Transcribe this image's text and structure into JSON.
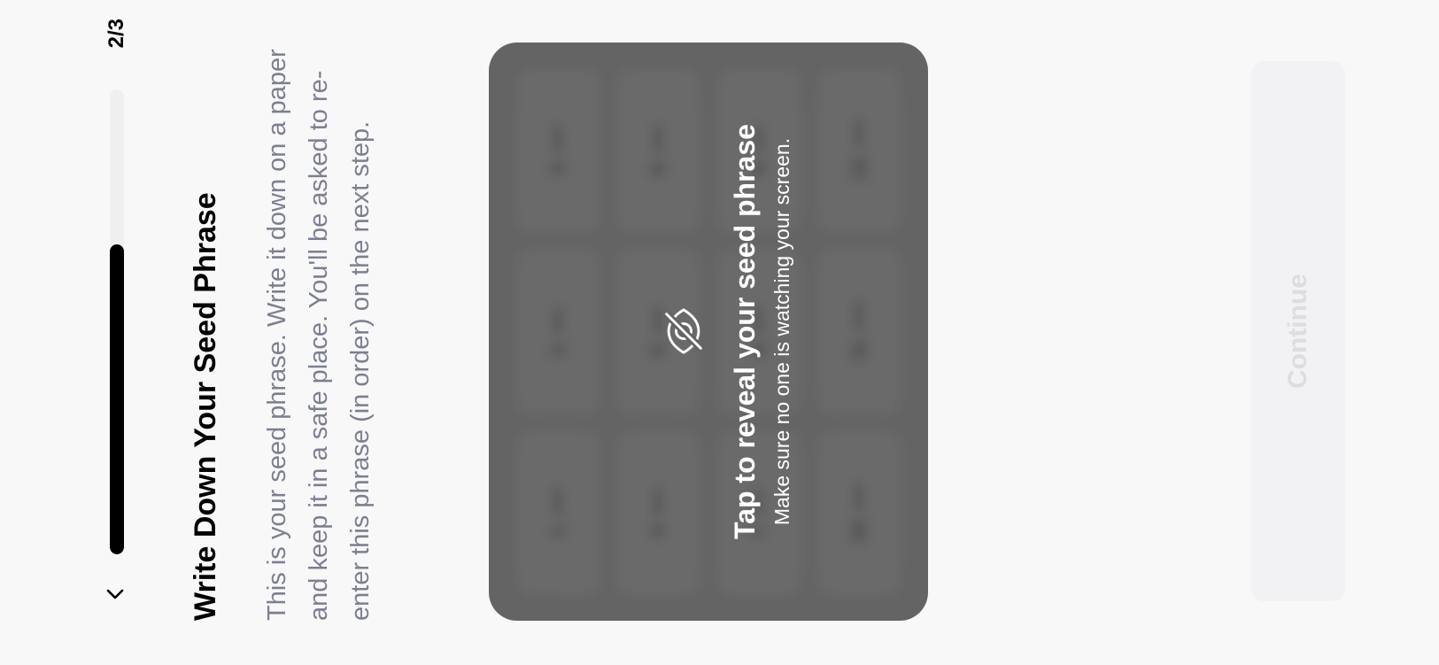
{
  "header": {
    "back_icon": "chevron-left-icon",
    "step_label": "2/3",
    "progress": 0.6667
  },
  "page": {
    "title": "Write Down Your Seed Phrase",
    "description": "This is your seed phrase. Write it down on a paper and keep it in a safe place. You'll be asked to re-enter this phrase (in order) on the next step."
  },
  "seed_card": {
    "icon": "eye-slash-icon",
    "reveal_title": "Tap to reveal your seed phrase",
    "reveal_hint": "Make sure no one is watching your screen.",
    "words": [
      "1. ••••",
      "2. ••••",
      "3. ••••",
      "4. ••••",
      "5. ••••",
      "6. ••••",
      "7. ••••",
      "8. ••••",
      "9. ••••",
      "10. ••••",
      "11. ••••",
      "12. ••••"
    ]
  },
  "footer": {
    "continue_label": "Continue",
    "continue_enabled": false
  },
  "colors": {
    "background": "#f8f8f8",
    "text_primary": "#000000",
    "text_secondary": "#7c7f93",
    "card_background": "#646464",
    "progress_fill": "#000000",
    "progress_track": "#efefef",
    "button_disabled_bg": "#f2f2f4",
    "button_disabled_text": "#dcdce2"
  }
}
